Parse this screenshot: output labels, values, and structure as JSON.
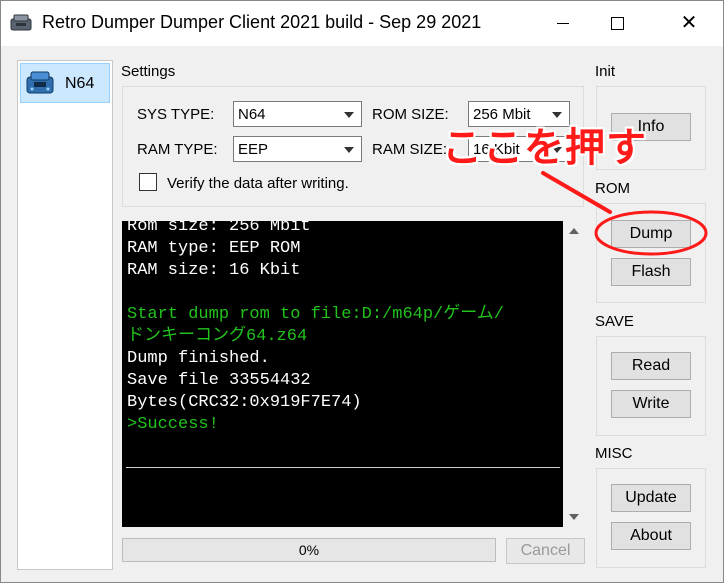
{
  "window": {
    "title": "Retro Dumper Dumper Client 2021 build - Sep 29 2021",
    "app_icon": "console-icon",
    "controls": {
      "minimize": "minimize-icon",
      "maximize": "maximize-icon",
      "close": "✕"
    }
  },
  "devices": [
    {
      "label": "N64",
      "icon": "n64-console-icon"
    }
  ],
  "settings": {
    "title": "Settings",
    "sys_type_label": "SYS TYPE:",
    "sys_type_value": "N64",
    "rom_size_label": "ROM SIZE:",
    "rom_size_value": "256 Mbit",
    "ram_type_label": "RAM TYPE:",
    "ram_type_value": "EEP",
    "ram_size_label": "RAM SIZE:",
    "ram_size_value": "16 Kbit",
    "verify_label": "Verify the data after writing.",
    "verify_checked": false
  },
  "log": {
    "lines": [
      {
        "text": "Rom size: 256 Mbit",
        "color": "#ffffff"
      },
      {
        "text": "RAM type: EEP ROM",
        "color": "#ffffff"
      },
      {
        "text": "RAM size: 16 Kbit",
        "color": "#ffffff"
      },
      {
        "text": "",
        "color": "#ffffff"
      },
      {
        "text": "Start dump rom to file:D:/m64p/ゲーム/",
        "color": "#22c21d"
      },
      {
        "text": "ドンキーコング64.z64",
        "color": "#22c21d"
      },
      {
        "text": "Dump finished.",
        "color": "#ffffff"
      },
      {
        "text": "Save file 33554432",
        "color": "#ffffff"
      },
      {
        "text": "Bytes(CRC32:0x919F7E74)",
        "color": "#ffffff"
      },
      {
        "text": ">Success!",
        "color": "#22c21d"
      }
    ]
  },
  "progress": {
    "value": 0,
    "text": "0%",
    "fill_color": "#06b025"
  },
  "cancel_label": "Cancel",
  "side": {
    "init": {
      "title": "Init",
      "info_label": "Info"
    },
    "rom": {
      "title": "ROM",
      "dump_label": "Dump",
      "flash_label": "Flash"
    },
    "save": {
      "title": "SAVE",
      "read_label": "Read",
      "write_label": "Write"
    },
    "misc": {
      "title": "MISC",
      "update_label": "Update",
      "about_label": "About"
    }
  },
  "annotation": {
    "text": "ここを押す",
    "color": "#ff1a1a"
  }
}
